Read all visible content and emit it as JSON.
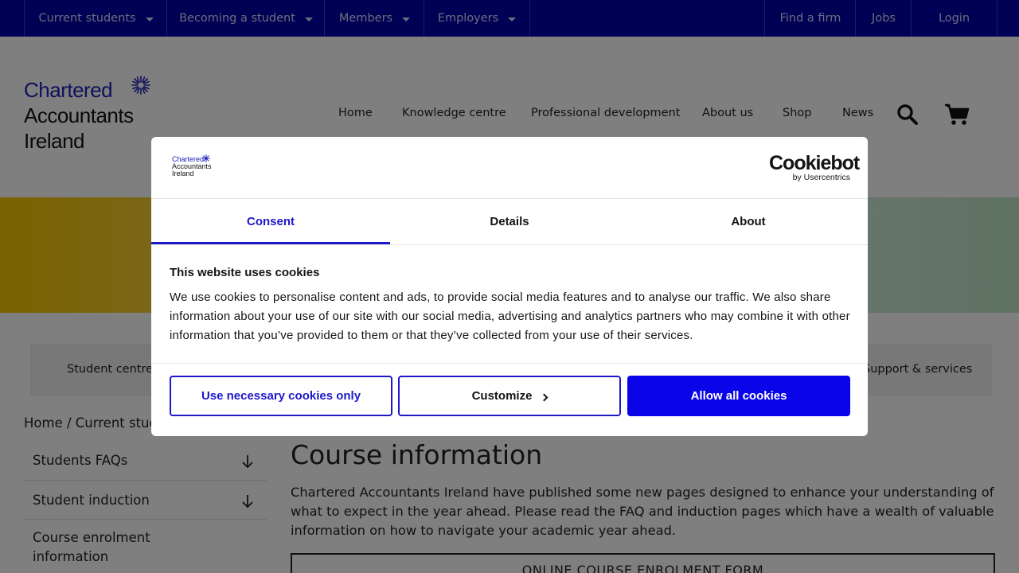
{
  "topbar": {
    "left_items": [
      "Current students",
      "Becoming a student",
      "Members",
      "Employers"
    ],
    "right_items": [
      "Find a firm",
      "Jobs",
      "Login"
    ]
  },
  "logo": {
    "line1": "Chartered",
    "line2": "Accountants",
    "line3": "Ireland"
  },
  "main_nav": [
    "Home",
    "Knowledge centre",
    "Professional development",
    "About us",
    "Shop",
    "News"
  ],
  "subnav": {
    "left": "Student centre",
    "right": "Support & services"
  },
  "breadcrumb": "Home / Current students",
  "sidebar": {
    "items": [
      {
        "label": "Students FAQs"
      },
      {
        "label": "Student induction"
      },
      {
        "label_line1": "Course enrolment",
        "label_line2": "information"
      }
    ]
  },
  "content": {
    "title": "Course information",
    "intro": "Chartered Accountants Ireland have published some new pages designed to enhance your understanding of what to expect in the year ahead. Please read the FAQ and induction pages which have a wealth of valuable information on how to navigate your academic year ahead.",
    "form_box": "ONLINE COURSE ENROLMENT FORM"
  },
  "cookie_dialog": {
    "brand_small": [
      "Chartered",
      "Accountants",
      "Ireland"
    ],
    "provider": "Cookiebot",
    "provider_sub": "by Usercentrics",
    "tabs": [
      "Consent",
      "Details",
      "About"
    ],
    "title": "This website uses cookies",
    "body": "We use cookies to personalise content and ads, to provide social media features and to analyse our traffic. We also share information about your use of our site with our social media, advertising and analytics partners who may combine it with other information that you’ve provided to them or that they’ve collected from your use of their services.",
    "buttons": {
      "necessary": "Use necessary cookies only",
      "customize": "Customize",
      "allow": "Allow all cookies"
    }
  },
  "colors": {
    "brand": "#0000a8",
    "accent": "#1d18c8",
    "allow_button": "#0a05e8"
  }
}
